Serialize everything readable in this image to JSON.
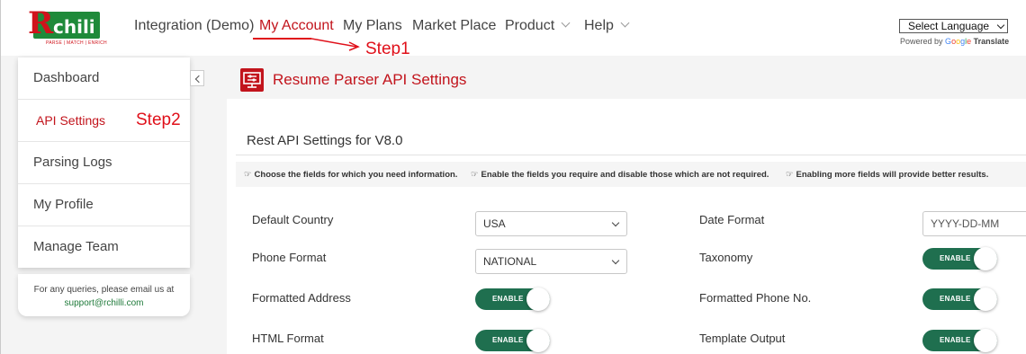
{
  "logo": {
    "text": "chili",
    "initial": "R",
    "tagline": "PARSE | MATCH | ENRICH"
  },
  "nav": {
    "items": [
      {
        "label": "Integration (Demo)"
      },
      {
        "label": "My Account"
      },
      {
        "label": "My Plans"
      },
      {
        "label": "Market Place"
      },
      {
        "label": "Product"
      },
      {
        "label": "Help"
      }
    ]
  },
  "annotations": {
    "step1": "Step1",
    "step2": "Step2",
    "color": "#e0101a"
  },
  "language": {
    "selected": "Select Language",
    "powered_by": "Powered by",
    "google": "Google",
    "translate": "Translate"
  },
  "sidebar": {
    "items": [
      {
        "label": "Dashboard"
      },
      {
        "label": "API Settings"
      },
      {
        "label": "Parsing Logs"
      },
      {
        "label": "My Profile"
      },
      {
        "label": "Manage Team"
      }
    ],
    "help_text": "For any queries, please email us at",
    "help_email": "support@rchilli.com"
  },
  "page": {
    "title": "Resume Parser API Settings",
    "section_title": "Rest API Settings for V8.0"
  },
  "hints": [
    "Choose the fields for which you need information.",
    "Enable the fields you require and disable those which are not required.",
    "Enabling more fields will provide better results."
  ],
  "fields": {
    "default_country": {
      "label": "Default Country",
      "value": "USA"
    },
    "phone_format": {
      "label": "Phone Format",
      "value": "NATIONAL"
    },
    "formatted_address": {
      "label": "Formatted Address",
      "state": "ENABLE"
    },
    "html_format": {
      "label": "HTML Format",
      "state": "ENABLE"
    },
    "date_format": {
      "label": "Date Format",
      "placeholder": "YYYY-DD-MM"
    },
    "taxonomy": {
      "label": "Taxonomy",
      "state": "ENABLE"
    },
    "formatted_phone": {
      "label": "Formatted Phone No.",
      "state": "ENABLE"
    },
    "template_output": {
      "label": "Template Output",
      "state": "ENABLE"
    }
  },
  "colors": {
    "brand_red": "#c2141c",
    "brand_green": "#1f8a3a",
    "toggle_green": "#1f6f4f"
  }
}
